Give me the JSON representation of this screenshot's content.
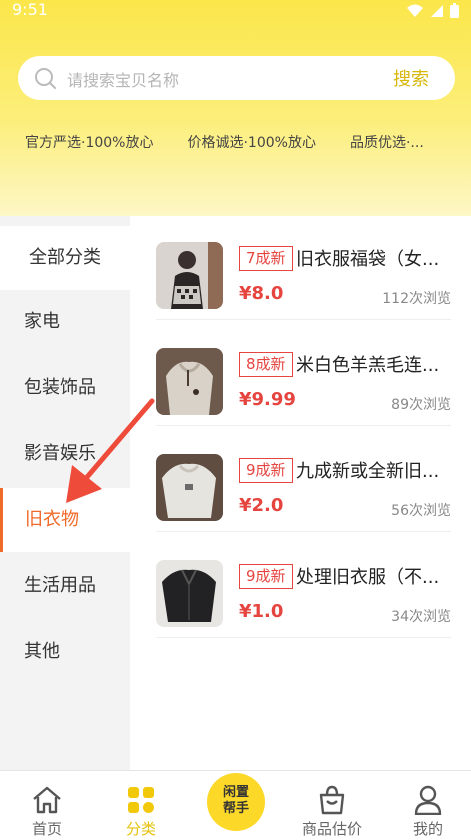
{
  "status": {
    "time": "9:51"
  },
  "search": {
    "placeholder": "请搜索宝贝名称",
    "button": "搜索"
  },
  "slogans": [
    "官方严选·100%放心",
    "价格诚选·100%放心",
    "品质优选·..."
  ],
  "sidebar": {
    "items": [
      {
        "label": "全部分类"
      },
      {
        "label": "家电"
      },
      {
        "label": "包装饰品"
      },
      {
        "label": "影音娱乐"
      },
      {
        "label": "旧衣物"
      },
      {
        "label": "生活用品"
      },
      {
        "label": "其他"
      }
    ],
    "active_index": 4
  },
  "products": [
    {
      "badge": "7成新",
      "title": "旧衣服福袋（女...",
      "price": "¥8.0",
      "views": "112次浏览"
    },
    {
      "badge": "8成新",
      "title": "米白色羊羔毛连...",
      "price": "¥9.99",
      "views": "89次浏览"
    },
    {
      "badge": "9成新",
      "title": "九成新或全新旧...",
      "price": "¥2.0",
      "views": "56次浏览"
    },
    {
      "badge": "9成新",
      "title": "处理旧衣服（不...",
      "price": "¥1.0",
      "views": "34次浏览"
    }
  ],
  "tabbar": {
    "home": "首页",
    "category": "分类",
    "center": "闲置帮手",
    "center_line1": "闲置",
    "center_line2": "帮手",
    "estimate": "商品估价",
    "mine": "我的"
  },
  "colors": {
    "accent": "#f06a2a",
    "price": "#e5443f",
    "brand_yellow": "#fcd829"
  }
}
